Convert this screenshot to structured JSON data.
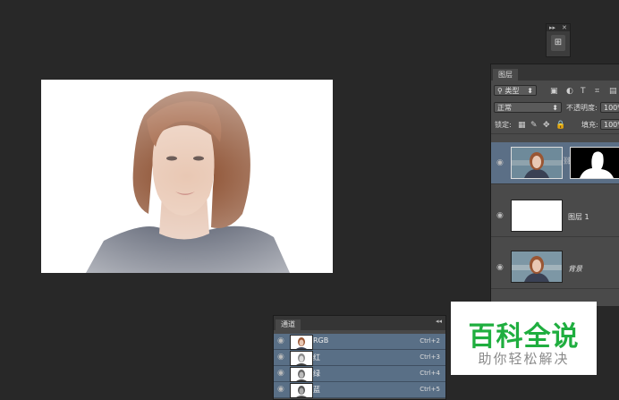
{
  "mini_panel": {
    "collapse_label": "▸▸",
    "close_label": "✕",
    "button_icon": "layers-compose-icon"
  },
  "layers_panel": {
    "tab": "图层",
    "filter_kind": "类型",
    "blend_mode": "正常",
    "opacity_label": "不透明度:",
    "opacity_value": "100%",
    "lock_label": "锁定:",
    "fill_label": "填充:",
    "fill_value": "100%",
    "layers": [
      {
        "name": "",
        "selected": true,
        "has_mask": true
      },
      {
        "name": "图层 1",
        "selected": false,
        "has_mask": false
      },
      {
        "name": "背景",
        "selected": false,
        "has_mask": false
      }
    ]
  },
  "channels_panel": {
    "tab": "通道",
    "channels": [
      {
        "name": "RGB",
        "shortcut": "Ctrl+2"
      },
      {
        "name": "红",
        "shortcut": "Ctrl+3"
      },
      {
        "name": "绿",
        "shortcut": "Ctrl+4"
      },
      {
        "name": "蓝",
        "shortcut": "Ctrl+5"
      }
    ]
  },
  "watermark": {
    "title": "百科全说",
    "subtitle": "助你轻松解决"
  },
  "colors": {
    "workspace": "#282828",
    "panel": "#4a4a4a",
    "selection": "#5b6f86",
    "watermark_green": "#1fae3f"
  }
}
